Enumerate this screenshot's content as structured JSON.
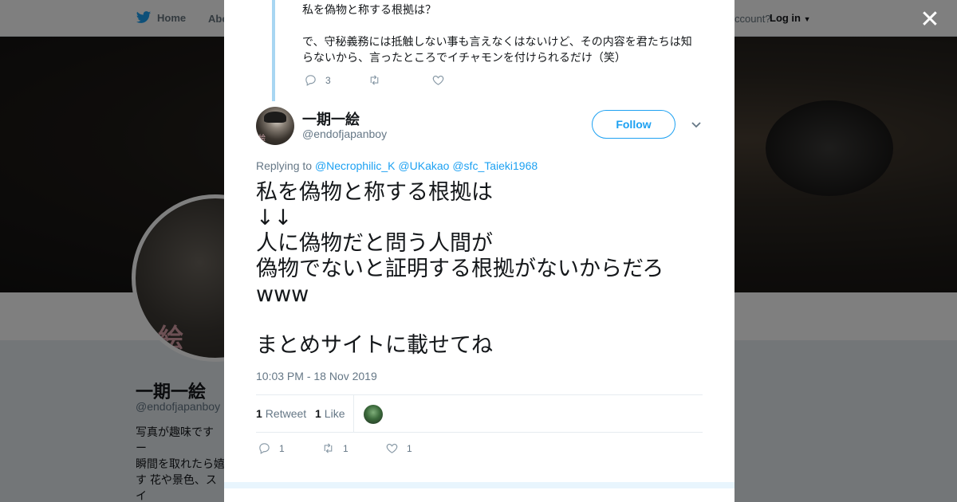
{
  "nav": {
    "home": "Home",
    "about": "Abo",
    "account_prompt": "ccount?",
    "login": "Log in"
  },
  "profile": {
    "name": "一期一絵",
    "handle": "@endofjapanboy",
    "avatar_mark": "絵",
    "bio": "写真が趣味です ー\n瞬間を取れたら嬉\nす 花や景色、スイ\nに政治に関しても\nくお願い致します"
  },
  "previous_tweet": {
    "text": "私を偽物と称する根拠は？\n\nで、守秘義務には抵触しない事も言えなくはないけど、その内容を君たちは知らないから、言ったところでイチャモンを付けられるだけ（笑）",
    "reply_count": "3",
    "retweet_count": "",
    "like_count": ""
  },
  "tweet": {
    "author_name": "一期一絵",
    "author_handle": "@endofjapanboy",
    "avatar_mark": "絵",
    "follow_label": "Follow",
    "replying_prefix": "Replying to",
    "replying_to": [
      "@Necrophilic_K",
      "@UKakao",
      "@sfc_Taieki1968"
    ],
    "text": "私を偽物と称する根拠は\n↓↓\n人に偽物だと問う人間が\n偽物でないと証明する根拠がないからだろ\nwww\n\nまとめサイトに載せてね",
    "timestamp": "10:03 PM - 18 Nov 2019",
    "retweets": "1",
    "retweets_label": "Retweet",
    "likes": "1",
    "likes_label": "Like",
    "action_reply_count": "1",
    "action_retweet_count": "1",
    "action_like_count": "1"
  },
  "icons": {
    "close": "close-icon",
    "reply": "reply-icon",
    "retweet": "retweet-icon",
    "like": "heart-icon",
    "caret": "chevron-down-icon",
    "bird": "twitter-bird-icon"
  },
  "colors": {
    "brand": "#1da1f2",
    "text": "#14171a",
    "muted": "#657786",
    "thread_line": "#a8d6f2"
  }
}
